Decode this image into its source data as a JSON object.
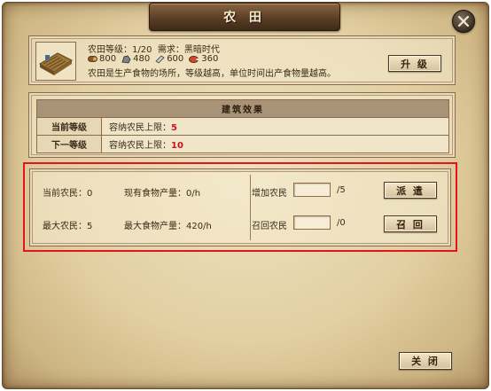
{
  "window": {
    "title": "农 田"
  },
  "building": {
    "level_text": "农田等级：1/20",
    "requirement_text": "需求：黑暗时代",
    "resources": [
      {
        "icon": "wood-log-icon",
        "amount": "800"
      },
      {
        "icon": "stone-icon",
        "amount": "480"
      },
      {
        "icon": "iron-icon",
        "amount": "600"
      },
      {
        "icon": "meat-icon",
        "amount": "360"
      }
    ],
    "description": "农田是生产食物的场所，等级越高，单位时间出产食物量越高。",
    "upgrade_label": "升 级"
  },
  "effects": {
    "header": "建筑效果",
    "rows": [
      {
        "label": "当前等级",
        "text": "容纳农民上限：",
        "value": "5"
      },
      {
        "label": "下一等级",
        "text": "容纳农民上限：",
        "value": "10"
      }
    ]
  },
  "workers": {
    "current_farmers": "当前农民：0",
    "current_food": "现有食物产量：0/h",
    "max_farmers": "最大农民：5",
    "max_food": "最大食物产量：420/h",
    "add_label": "增加农民",
    "add_value": "",
    "add_limit": "/5",
    "recall_label": "召回农民",
    "recall_value": "",
    "recall_limit": "/0",
    "dispatch_button": "派 遣",
    "recall_button": "召 回"
  },
  "footer": {
    "close_button": "关 闭"
  },
  "colors": {
    "highlight_border": "#e4141e",
    "value_red": "#c8141a"
  }
}
